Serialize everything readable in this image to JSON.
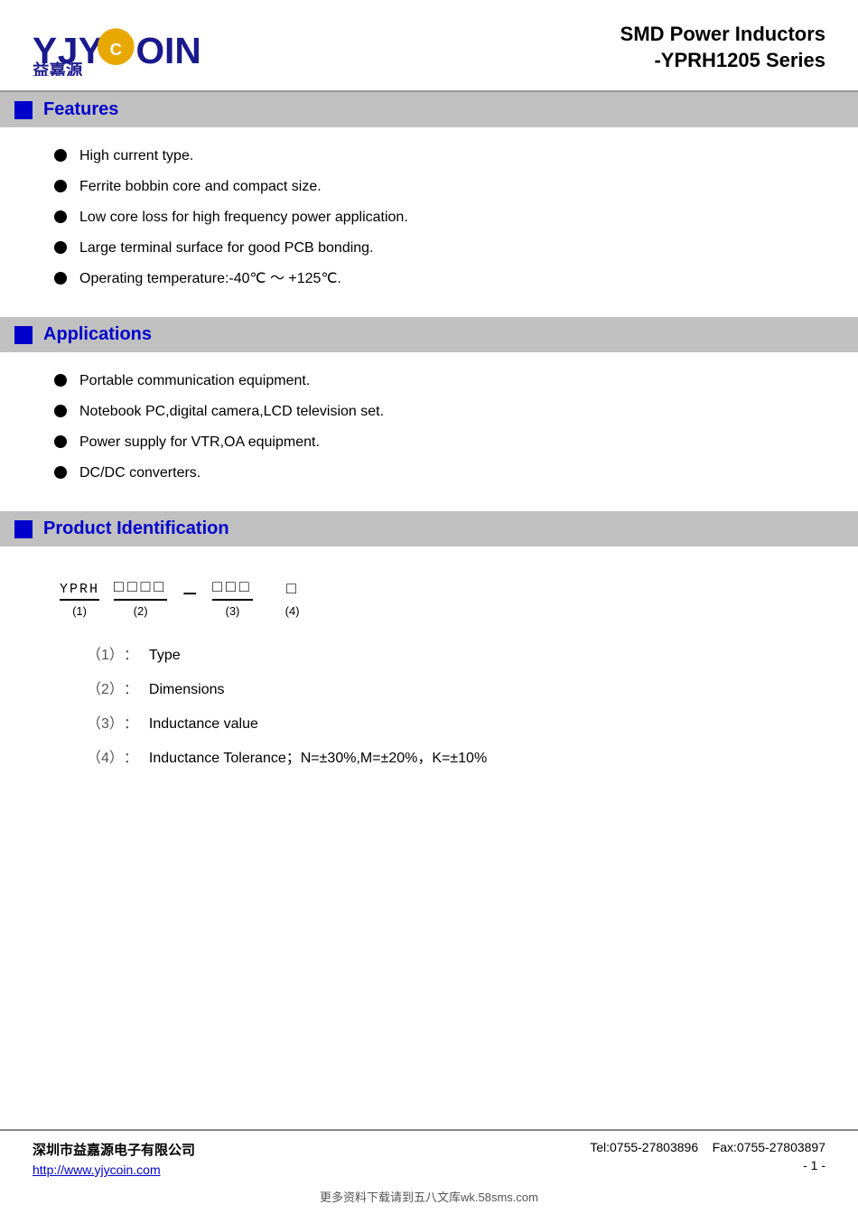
{
  "header": {
    "product_line": "SMD Power Inductors",
    "series": "-YPRH1205 Series",
    "logo_text_cn": "益嘉源"
  },
  "features": {
    "section_title": "Features",
    "items": [
      "High current type.",
      "Ferrite bobbin core and compact size.",
      "Low core loss for high frequency power application.",
      "Large terminal surface for good PCB bonding.",
      "Operating temperature:-40℃ ～ +125℃."
    ]
  },
  "applications": {
    "section_title": "Applications",
    "items": [
      "Portable communication equipment.",
      "Notebook PC,digital camera,LCD television set.",
      "Power supply for VTR,OA equipment.",
      "DC/DC converters."
    ]
  },
  "product_identification": {
    "section_title": "Product Identification",
    "diagram": {
      "part1_label": "YPRH",
      "part1_num": "(1)",
      "part2_boxes": "□□□□",
      "part2_num": "(2)",
      "part3_boxes": "□□□",
      "part3_num": "(3)",
      "part4_box": "□",
      "part4_num": "(4)"
    },
    "descriptions": [
      {
        "num": "（1）",
        "label": "Type"
      },
      {
        "num": "（2）",
        "label": "Dimensions"
      },
      {
        "num": "（3）",
        "label": "Inductance value"
      },
      {
        "num": "（4）",
        "label": "Inductance Tolerance；N=±30%,M=±20%，K=±10%"
      }
    ]
  },
  "footer": {
    "company_name": "深圳市益嘉源电子有限公司",
    "website": "http://www.yjycoin.com",
    "tel": "Tel:0755-27803896",
    "fax": "Fax:0755-27803897",
    "page": "- 1 -",
    "watermark": "更多资料下载请到五八文库wk.58sms.com"
  }
}
